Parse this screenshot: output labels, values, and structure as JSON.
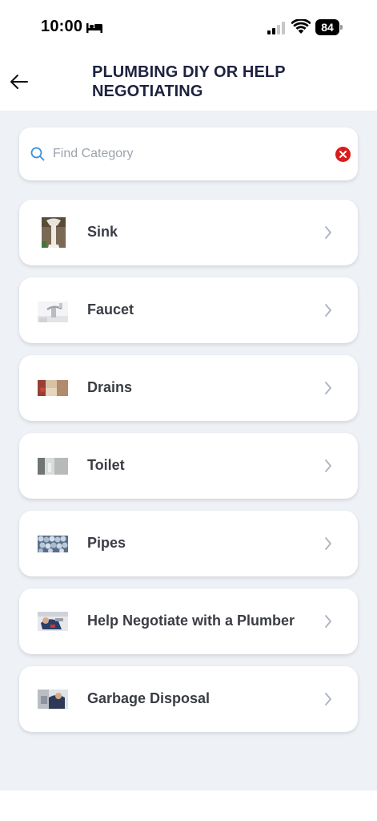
{
  "status_bar": {
    "time": "10:00",
    "battery": "84"
  },
  "header": {
    "title": "PLUMBING DIY OR HELP NEGOTIATING",
    "back_icon": "arrow-left-icon"
  },
  "search": {
    "placeholder": "Find Category",
    "value": "",
    "icon": "search-icon",
    "clear_icon": "clear-icon"
  },
  "categories": [
    {
      "label": "Sink",
      "thumb": "sink-thumbnail"
    },
    {
      "label": "Faucet",
      "thumb": "faucet-thumbnail"
    },
    {
      "label": "Drains",
      "thumb": "drains-thumbnail"
    },
    {
      "label": "Toilet",
      "thumb": "toilet-thumbnail"
    },
    {
      "label": "Pipes",
      "thumb": "pipes-thumbnail"
    },
    {
      "label": "Help Negotiate with a Plumber",
      "thumb": "plumber-thumbnail"
    },
    {
      "label": "Garbage Disposal",
      "thumb": "garbage-disposal-thumbnail"
    }
  ],
  "colors": {
    "title": "#1d2240",
    "background": "#eef1f6",
    "card": "#ffffff",
    "accent_search": "#3b8ee0",
    "clear": "#d91c1c",
    "chevron": "#aab3c0"
  }
}
